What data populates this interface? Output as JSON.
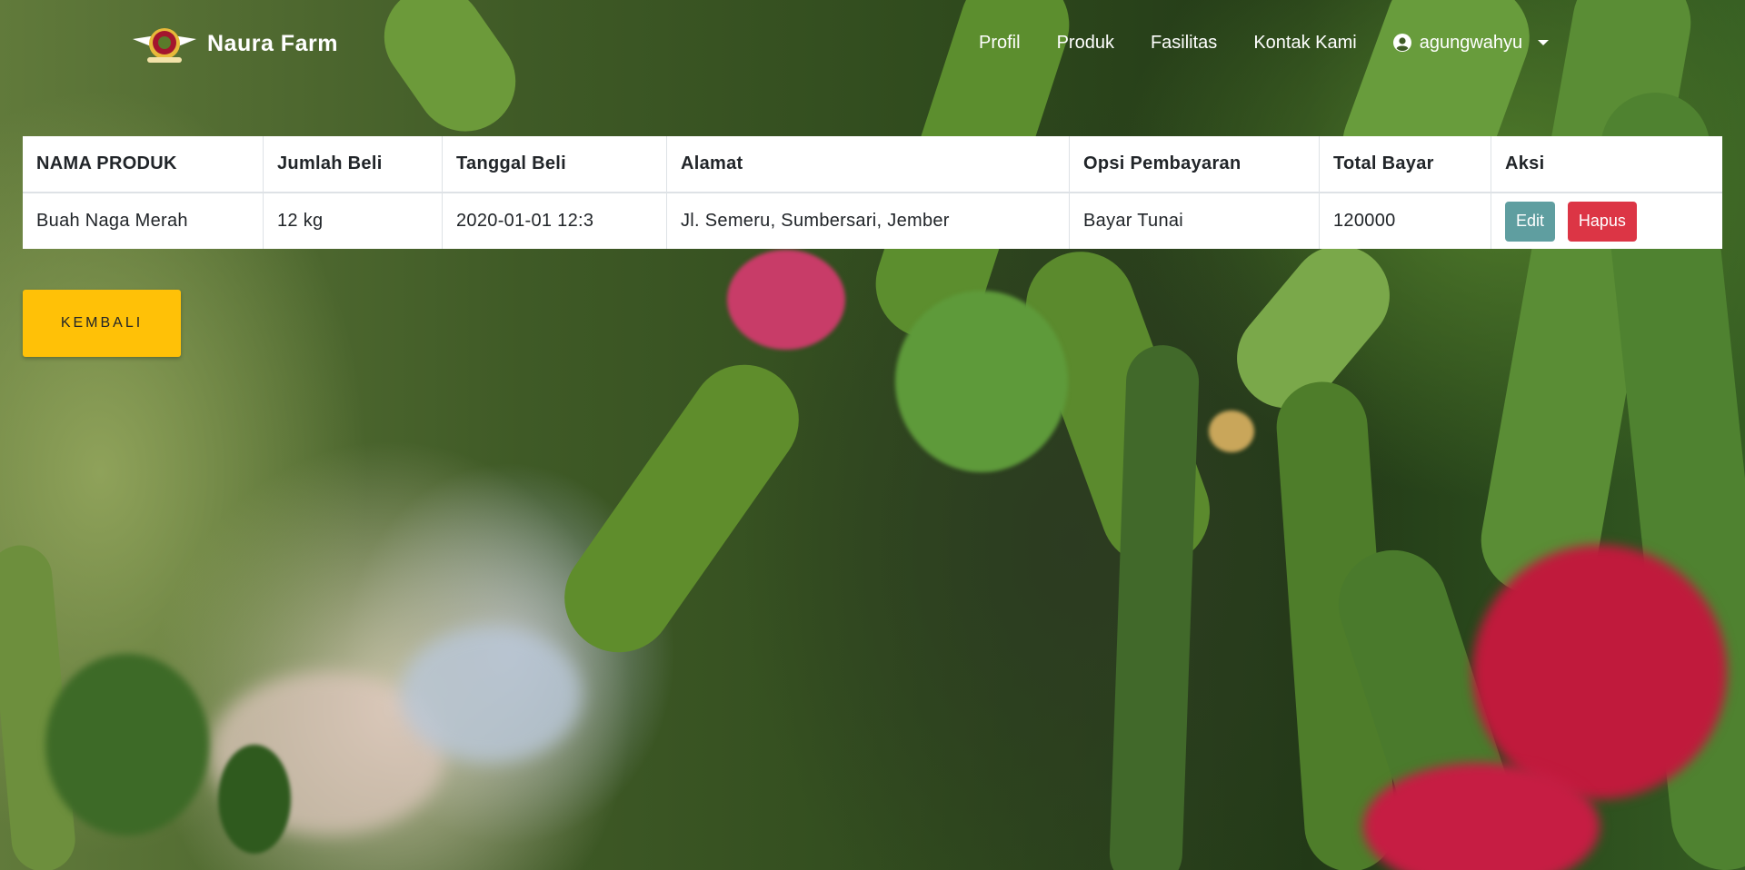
{
  "navbar": {
    "brand": "Naura Farm",
    "links": [
      {
        "label": "Profil"
      },
      {
        "label": "Produk"
      },
      {
        "label": "Fasilitas"
      },
      {
        "label": "Kontak Kami"
      }
    ],
    "user": {
      "name": "agungwahyu",
      "icon": "user-circle-icon"
    }
  },
  "table": {
    "headers": [
      "NAMA PRODUK",
      "Jumlah Beli",
      "Tanggal Beli",
      "Alamat",
      "Opsi Pembayaran",
      "Total Bayar",
      "Aksi"
    ],
    "rows": [
      {
        "nama_produk": "Buah Naga Merah",
        "jumlah_beli": "12 kg",
        "tanggal_beli": "2020-01-01 12:3",
        "alamat": "Jl. Semeru, Sumbersari, Jember",
        "opsi_pembayaran": "Bayar Tunai",
        "total_bayar": "120000",
        "edit_label": "Edit",
        "hapus_label": "Hapus"
      }
    ]
  },
  "back_button": {
    "label": "KEMBALI"
  },
  "colors": {
    "edit": "#5f9ea0",
    "hapus": "#dc3545",
    "kembali": "#ffc107"
  }
}
